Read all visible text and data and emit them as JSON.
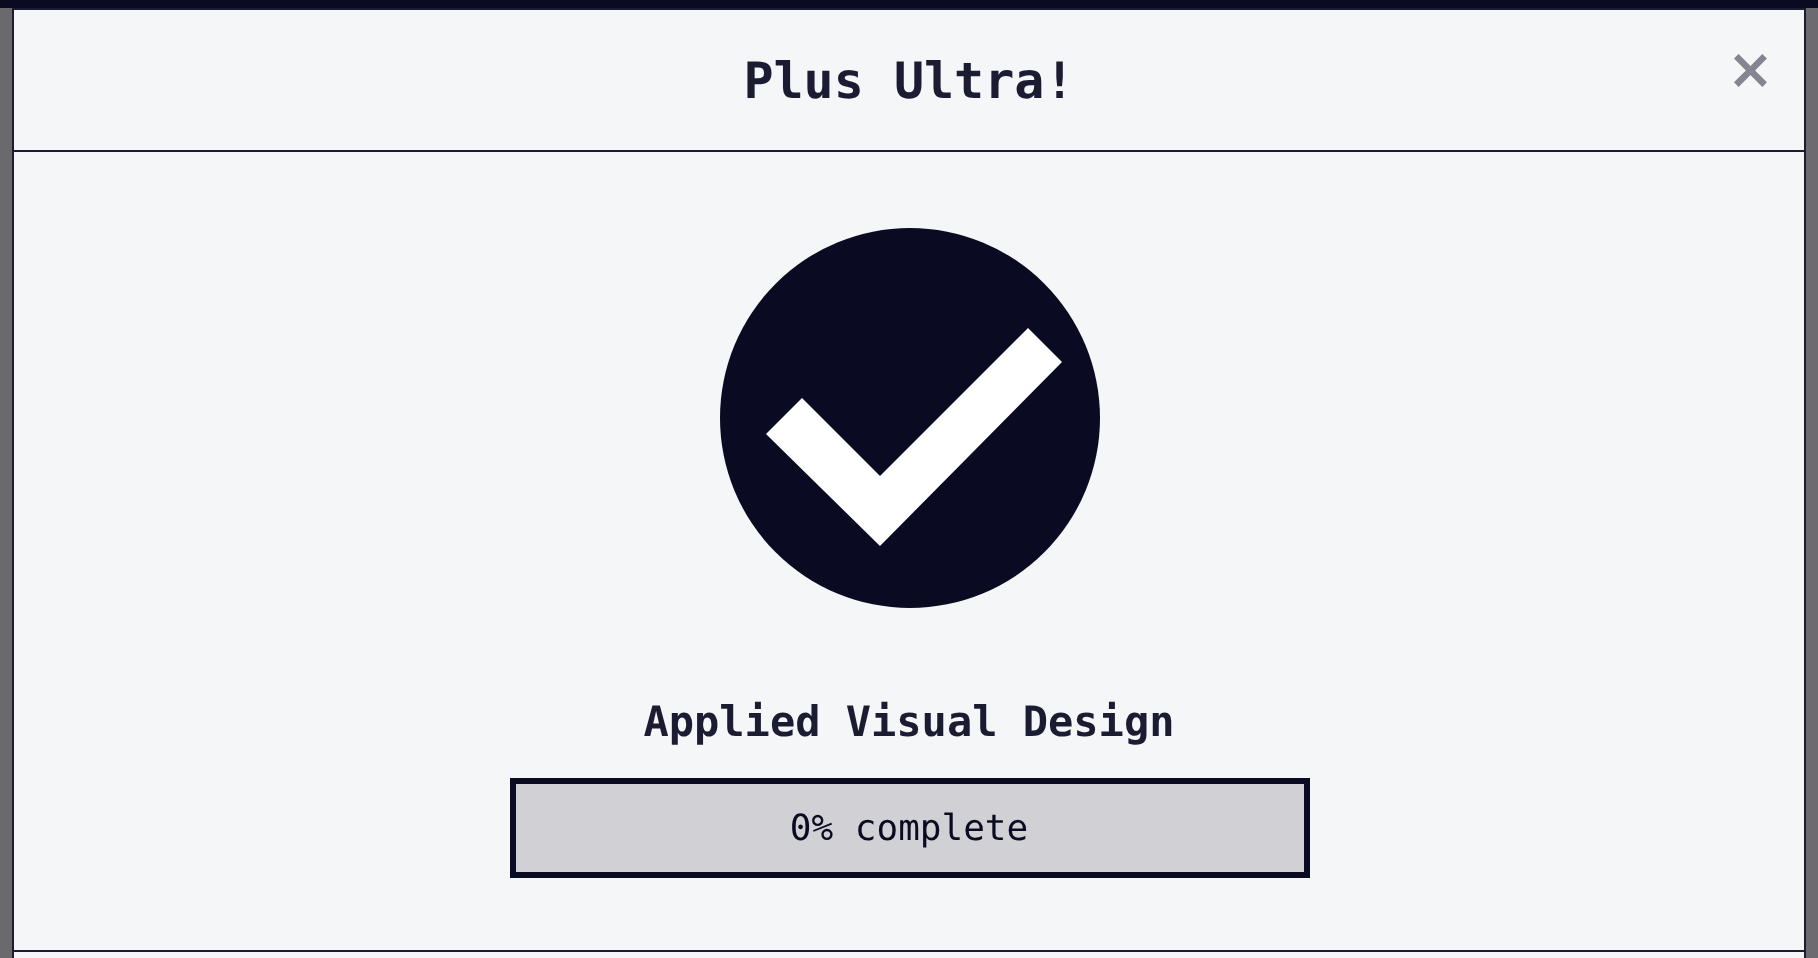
{
  "modal": {
    "title": "Plus Ultra!",
    "close": "×"
  },
  "block": {
    "title": "Applied Visual Design"
  },
  "progress": {
    "level": 0,
    "label": "0% complete"
  }
}
